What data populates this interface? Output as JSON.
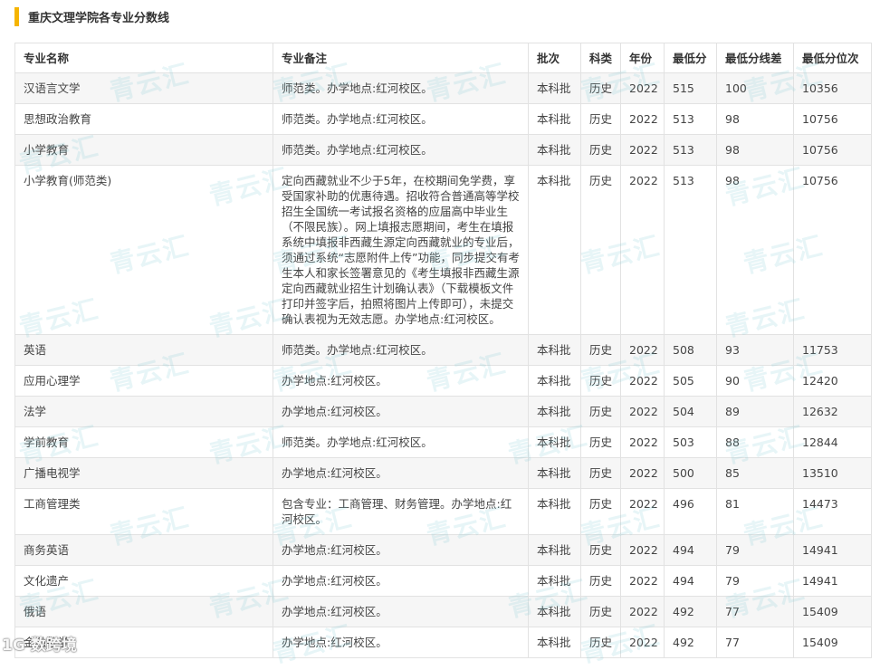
{
  "page": {
    "title": "重庆文理学院各专业分数线"
  },
  "watermark": {
    "text": "青云汇"
  },
  "footer": {
    "text": "1G 数跨境"
  },
  "table": {
    "headers": [
      "专业名称",
      "专业备注",
      "批次",
      "科类",
      "年份",
      "最低分",
      "最低分线差",
      "最低分位次"
    ],
    "rows": [
      [
        "汉语言文学",
        "师范类。办学地点:红河校区。",
        "本科批",
        "历史",
        "2022",
        "515",
        "100",
        "10356"
      ],
      [
        "思想政治教育",
        "师范类。办学地点:红河校区。",
        "本科批",
        "历史",
        "2022",
        "513",
        "98",
        "10756"
      ],
      [
        "小学教育",
        "师范类。办学地点:红河校区。",
        "本科批",
        "历史",
        "2022",
        "513",
        "98",
        "10756"
      ],
      [
        "小学教育(师范类)",
        "定向西藏就业不少于5年，在校期间免学费，享受国家补助的优惠待遇。招收符合普通高等学校招生全国统一考试报名资格的应届高中毕业生（不限民族）。网上填报志愿期间，考生在填报系统中填报非西藏生源定向西藏就业的专业后，须通过系统“志愿附件上传”功能，同步提交有考生本人和家长签署意见的《考生填报非西藏生源定向西藏就业招生计划确认表》（下载模板文件打印并签字后，拍照将图片上传即可），未提交确认表视为无效志愿。办学地点:红河校区。",
        "本科批",
        "历史",
        "2022",
        "513",
        "98",
        "10756"
      ],
      [
        "英语",
        "师范类。办学地点:红河校区。",
        "本科批",
        "历史",
        "2022",
        "508",
        "93",
        "11753"
      ],
      [
        "应用心理学",
        "办学地点:红河校区。",
        "本科批",
        "历史",
        "2022",
        "505",
        "90",
        "12420"
      ],
      [
        "法学",
        "办学地点:红河校区。",
        "本科批",
        "历史",
        "2022",
        "504",
        "89",
        "12632"
      ],
      [
        "学前教育",
        "师范类。办学地点:红河校区。",
        "本科批",
        "历史",
        "2022",
        "503",
        "88",
        "12844"
      ],
      [
        "广播电视学",
        "办学地点:红河校区。",
        "本科批",
        "历史",
        "2022",
        "500",
        "85",
        "13510"
      ],
      [
        "工商管理类",
        "包含专业：工商管理、财务管理。办学地点:红河校区。",
        "本科批",
        "历史",
        "2022",
        "496",
        "81",
        "14473"
      ],
      [
        "商务英语",
        "办学地点:红河校区。",
        "本科批",
        "历史",
        "2022",
        "494",
        "79",
        "14941"
      ],
      [
        "文化遗产",
        "办学地点:红河校区。",
        "本科批",
        "历史",
        "2022",
        "494",
        "79",
        "14941"
      ],
      [
        "俄语",
        "办学地点:红河校区。",
        "本科批",
        "历史",
        "2022",
        "492",
        "77",
        "15409"
      ],
      [
        "金融数学",
        "办学地点:红河校区。",
        "本科批",
        "历史",
        "2022",
        "492",
        "77",
        "15409"
      ]
    ]
  }
}
